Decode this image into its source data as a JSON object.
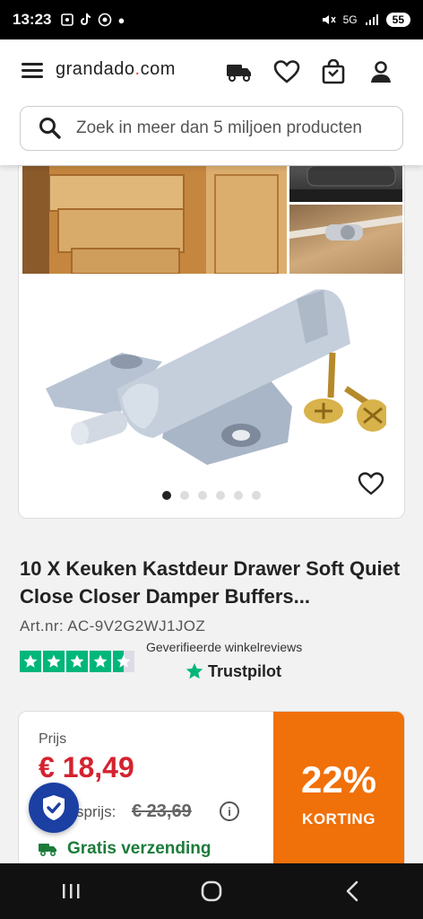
{
  "status_bar": {
    "time": "13:23",
    "battery": "55",
    "network": "5G"
  },
  "header": {
    "logo_main": "grandado",
    "logo_dot": ".",
    "logo_tld": "com",
    "search_placeholder": "Zoek in meer dan 5 miljoen producten"
  },
  "gallery": {
    "active_index": 0,
    "image_count": 6
  },
  "product": {
    "title": "10 X Keuken Kastdeur Drawer Soft Quiet Close Closer Damper Buffers...",
    "art_nr": "Art.nr: AC-9V2G2WJ1JOZ",
    "rating_stars": 4.5,
    "reviews_label": "Geverifieerde winkelreviews",
    "trustpilot_label": "Trustpilot"
  },
  "pricing": {
    "price_label": "Prijs",
    "price": "€ 18,49",
    "old_price_label": "sprijs:",
    "old_price": "€ 23,69",
    "info_symbol": "i",
    "shipping": "Gratis verzending",
    "discount_pct": "22%",
    "discount_label": "KORTING"
  },
  "colors": {
    "accent_red": "#d5222f",
    "discount_orange": "#f07009",
    "trust_green": "#00b67a",
    "shipping_green": "#1c7c3a",
    "shield_blue": "#1b3fa3"
  }
}
